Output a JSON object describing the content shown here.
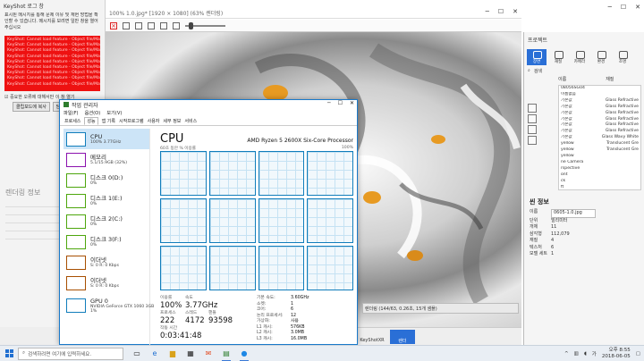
{
  "keyshot": {
    "left_title": "KeyShot 로그 창",
    "left_note": "표시된 메시지를 통해 문제 이유 및 재현 방법을 확인할 수 있습니다. 메시지를 보려면 일반 창을 열어 주십시오",
    "red_lines": [
      "KeyShot: Cannot load feature - Object file/Mat...",
      "KeyShot: Cannot load feature - Object file/Mat...",
      "KeyShot: Cannot load feature - Object file/Mat...",
      "KeyShot: Cannot load feature - Object file/Mat...",
      "KeyShot: Cannot load feature - Object file/Mat...",
      "KeyShot: Cannot load feature - Object file/Mat...",
      "KeyShot: Cannot load feature - Object file/Mat...",
      "KeyShot: Cannot load feature - Object file/Mat...",
      "KeyShot: Cannot load feature - Object file/Mat..."
    ],
    "checkbox_label": "중요한 오류에 대해서만 이 창 열기",
    "btn_copy": "클립보드에 복사",
    "btn_close": "닫기",
    "left_section": "렌더링 정보",
    "left_bottom_left": "클라우드 라이브러리",
    "window_title": "100% 1.0.jpg* [1920 × 1080] (63% 렌더링)",
    "status_text": "렌더링 (144/63, 0.26초, 15개 샘플)",
    "bottom_keyshotxr": "KeyShotXR",
    "bottom_render": "렌더"
  },
  "project_panel": {
    "title": "프로젝트",
    "tabs": [
      "장면",
      "재질",
      "카메라",
      "환경",
      "조명",
      "이미지"
    ],
    "search_placeholder": "검색",
    "col_name": "이름",
    "col_material": "재질",
    "scene_rows": [
      [
        "08056SG04",
        ""
      ],
      [
        "이름없음",
        ""
      ],
      [
        "기본값",
        "Glass Refractive"
      ],
      [
        "기본값",
        "Glass Refractive"
      ],
      [
        "기본값",
        "Glass Refractive"
      ],
      [
        "기본값",
        "Glass Refractive"
      ],
      [
        "기본값",
        "Glass Refractive"
      ],
      [
        "기본값",
        "Glass Refractive"
      ],
      [
        "기본값",
        "Glass Wavy White"
      ],
      [
        "yellow",
        "Translucent Gre"
      ],
      [
        "yellow",
        "Translucent Gre"
      ],
      [
        "yellow",
        ""
      ],
      [
        "ne Camera",
        ""
      ],
      [
        "rspective",
        ""
      ],
      [
        "ont",
        ""
      ],
      [
        "ck",
        ""
      ],
      [
        "ft",
        ""
      ],
      [
        "ght",
        ""
      ]
    ],
    "section_title": "씬 정보",
    "props": [
      [
        "이름",
        "0605-1.0.jpg"
      ],
      [
        "단위",
        "밀리미터"
      ],
      [
        "개체",
        "11"
      ],
      [
        "삼각형",
        "112,079"
      ],
      [
        "재질",
        "4"
      ],
      [
        "텍스처",
        "6"
      ],
      [
        "모델 세트",
        "1"
      ]
    ]
  },
  "taskmanager": {
    "title": "작업 관리자",
    "menu": [
      "파일(F)",
      "옵션(O)",
      "보기(V)"
    ],
    "tabs": [
      "프로세스",
      "성능",
      "앱 기록",
      "시작프로그램",
      "사용자",
      "세부 정보",
      "서비스"
    ],
    "active_tab": "성능",
    "side": [
      {
        "name": "CPU",
        "sub": "100% 3.77GHz"
      },
      {
        "name": "메모리",
        "sub": "5.1/15.9GB (32%)"
      },
      {
        "name": "디스크 0(D:)",
        "sub": "0%"
      },
      {
        "name": "디스크 1(E:)",
        "sub": "0%"
      },
      {
        "name": "디스크 2(C:)",
        "sub": "0%"
      },
      {
        "name": "디스크 3(F:)",
        "sub": "0%"
      },
      {
        "name": "이더넷",
        "sub": "S: 0 R: 0 Kbps"
      },
      {
        "name": "이더넷",
        "sub": "S: 0 R: 0 Kbps"
      },
      {
        "name": "GPU 0",
        "sub": "NVIDIA GeForce GTX 1060 3GB",
        "sub2": "1%"
      }
    ],
    "cpu_title": "CPU",
    "cpu_model": "AMD Ryzen 5 2600X Six-Core Processor",
    "graph_label": "60초 동안 % 이용률",
    "graph_max": "100%",
    "stats": {
      "util_label": "이용률",
      "util": "100%",
      "speed_label": "속도",
      "speed": "3.77GHz",
      "proc_label": "프로세스",
      "proc": "222",
      "thread_label": "스레드",
      "thread": "4172",
      "handle_label": "핸들",
      "handle": "93598",
      "uptime_label": "작동 시간",
      "uptime": "0:03:41:48"
    },
    "details": [
      [
        "기본 속도:",
        "3.60GHz"
      ],
      [
        "소켓:",
        "1"
      ],
      [
        "코어:",
        "6"
      ],
      [
        "논리 프로세서:",
        "12"
      ],
      [
        "가상화:",
        "사용"
      ],
      [
        "L1 캐시:",
        "576KB"
      ],
      [
        "L2 캐시:",
        "3.0MB"
      ],
      [
        "L3 캐시:",
        "16.0MB"
      ]
    ]
  },
  "taskbar": {
    "search_placeholder": "검색하려면 여기에 입력하세요.",
    "time": "오후 8:55",
    "date": "2018-06-05",
    "lang": "가"
  },
  "colors": {
    "accent": "#1979ca",
    "cpu_graph": "#117dbb",
    "memory": "#8b12ae",
    "disk": "#4da60c",
    "ethernet": "#a74f01",
    "error_red": "#ee1111"
  }
}
